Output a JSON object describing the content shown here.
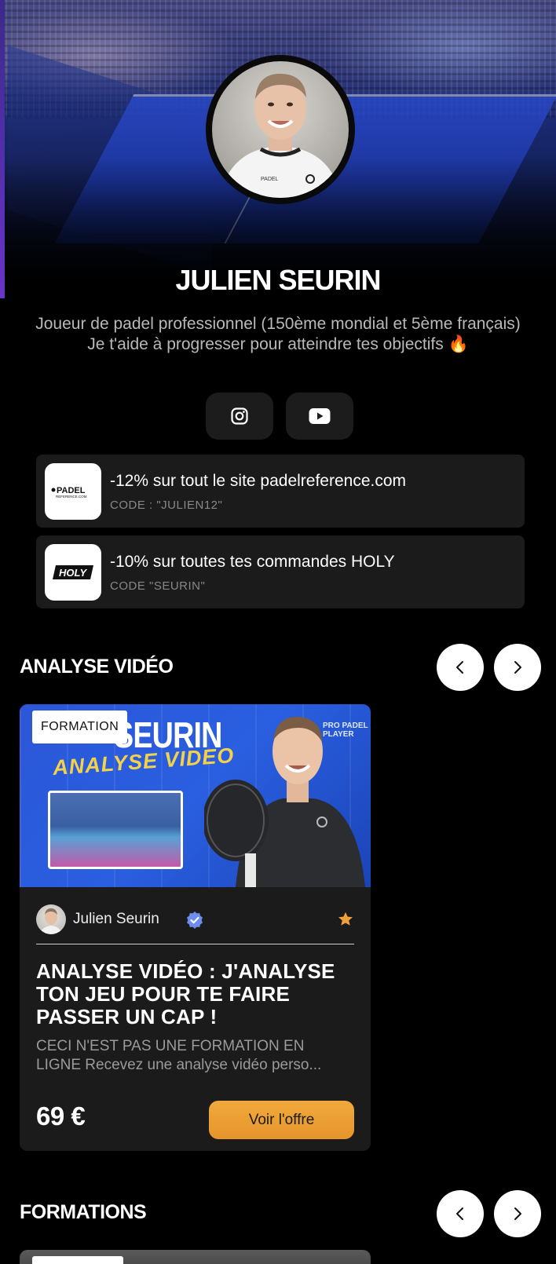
{
  "profile": {
    "name": "JULIEN SEURIN",
    "bio_line1": "Joueur de padel professionnel (150ème mondial et 5ème français)",
    "bio_line2": "Je t'aide à progresser pour atteindre tes objectifs 🔥"
  },
  "socials": [
    {
      "icon": "instagram-icon"
    },
    {
      "icon": "youtube-icon"
    }
  ],
  "coupons": [
    {
      "title": "-12% sur tout le site padelreference.com",
      "code": "CODE : \"JULIEN12\"",
      "logo_text": "PADEL",
      "logo_sub": "REFERENCE.COM"
    },
    {
      "title": "-10% sur toutes tes commandes HOLY",
      "code": "CODE \"SEURIN\"",
      "logo_text": "HOLY"
    }
  ],
  "sections": {
    "analyse": {
      "title": "ANALYSE VIDÉO"
    },
    "formations": {
      "title": "FORMATIONS"
    }
  },
  "card": {
    "badge": "FORMATION",
    "thumb_title": "SEURIN",
    "thumb_script": "ANALYSE VIDEO",
    "thumb_pro": "PRO PADEL PLAYER",
    "author": "Julien Seurin",
    "title": "ANALYSE VIDÉO : J'ANALYSE TON JEU POUR TE FAIRE PASSER UN CAP !",
    "description": "CECI N'EST PAS UNE FORMATION EN LIGNE Recevez une analyse vidéo perso...",
    "price": "69 €",
    "cta": "Voir l'offre"
  },
  "colors": {
    "accent": "#eda13a",
    "card_bg": "#1b1b1b",
    "verified": "#6f8df0",
    "star": "#f0a03a"
  }
}
